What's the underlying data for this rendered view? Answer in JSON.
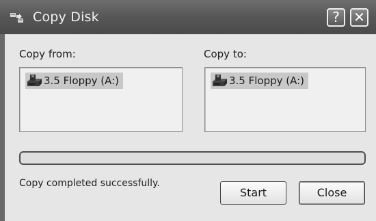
{
  "window": {
    "title": "Copy Disk",
    "help_label": "?",
    "close_label": "✕"
  },
  "copy_from": {
    "label": "Copy from:",
    "items": [
      {
        "label": "3.5 Floppy (A:)",
        "icon": "floppy-drive-icon"
      }
    ]
  },
  "copy_to": {
    "label": "Copy to:",
    "items": [
      {
        "label": "3.5 Floppy (A:)",
        "icon": "floppy-drive-icon"
      }
    ]
  },
  "progress": {
    "value": 0
  },
  "status": {
    "text": "Copy completed successfully."
  },
  "buttons": {
    "start_label": "Start",
    "close_label": "Close"
  }
}
